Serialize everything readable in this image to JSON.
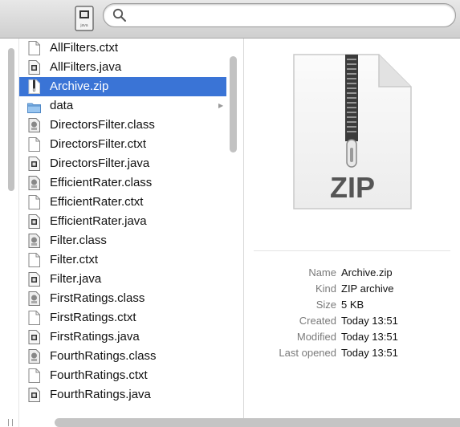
{
  "search": {
    "placeholder": "",
    "value": ""
  },
  "toolbar": {
    "doc_icon_label": "java"
  },
  "files": [
    {
      "name": "AllFilters.ctxt",
      "icon": "blank-document-icon",
      "selected": false,
      "folder": false
    },
    {
      "name": "AllFilters.java",
      "icon": "java-document-icon",
      "selected": false,
      "folder": false
    },
    {
      "name": "Archive.zip",
      "icon": "zip-document-icon",
      "selected": true,
      "folder": false
    },
    {
      "name": "data",
      "icon": "folder-icon",
      "selected": false,
      "folder": true
    },
    {
      "name": "DirectorsFilter.class",
      "icon": "class-document-icon",
      "selected": false,
      "folder": false
    },
    {
      "name": "DirectorsFilter.ctxt",
      "icon": "blank-document-icon",
      "selected": false,
      "folder": false
    },
    {
      "name": "DirectorsFilter.java",
      "icon": "java-document-icon",
      "selected": false,
      "folder": false
    },
    {
      "name": "EfficientRater.class",
      "icon": "class-document-icon",
      "selected": false,
      "folder": false
    },
    {
      "name": "EfficientRater.ctxt",
      "icon": "blank-document-icon",
      "selected": false,
      "folder": false
    },
    {
      "name": "EfficientRater.java",
      "icon": "java-document-icon",
      "selected": false,
      "folder": false
    },
    {
      "name": "Filter.class",
      "icon": "class-document-icon",
      "selected": false,
      "folder": false
    },
    {
      "name": "Filter.ctxt",
      "icon": "blank-document-icon",
      "selected": false,
      "folder": false
    },
    {
      "name": "Filter.java",
      "icon": "java-document-icon",
      "selected": false,
      "folder": false
    },
    {
      "name": "FirstRatings.class",
      "icon": "class-document-icon",
      "selected": false,
      "folder": false
    },
    {
      "name": "FirstRatings.ctxt",
      "icon": "blank-document-icon",
      "selected": false,
      "folder": false
    },
    {
      "name": "FirstRatings.java",
      "icon": "java-document-icon",
      "selected": false,
      "folder": false
    },
    {
      "name": "FourthRatings.class",
      "icon": "class-document-icon",
      "selected": false,
      "folder": false
    },
    {
      "name": "FourthRatings.ctxt",
      "icon": "blank-document-icon",
      "selected": false,
      "folder": false
    },
    {
      "name": "FourthRatings.java",
      "icon": "java-document-icon",
      "selected": false,
      "folder": false
    }
  ],
  "preview": {
    "badge": "ZIP",
    "info": [
      {
        "label": "Name",
        "value": "Archive.zip"
      },
      {
        "label": "Kind",
        "value": "ZIP archive"
      },
      {
        "label": "Size",
        "value": "5 KB"
      },
      {
        "label": "Created",
        "value": "Today 13:51"
      },
      {
        "label": "Modified",
        "value": "Today 13:51"
      },
      {
        "label": "Last opened",
        "value": "Today 13:51"
      }
    ]
  },
  "colors": {
    "selection": "#3a74d6",
    "info_label": "#7a7a7a"
  }
}
